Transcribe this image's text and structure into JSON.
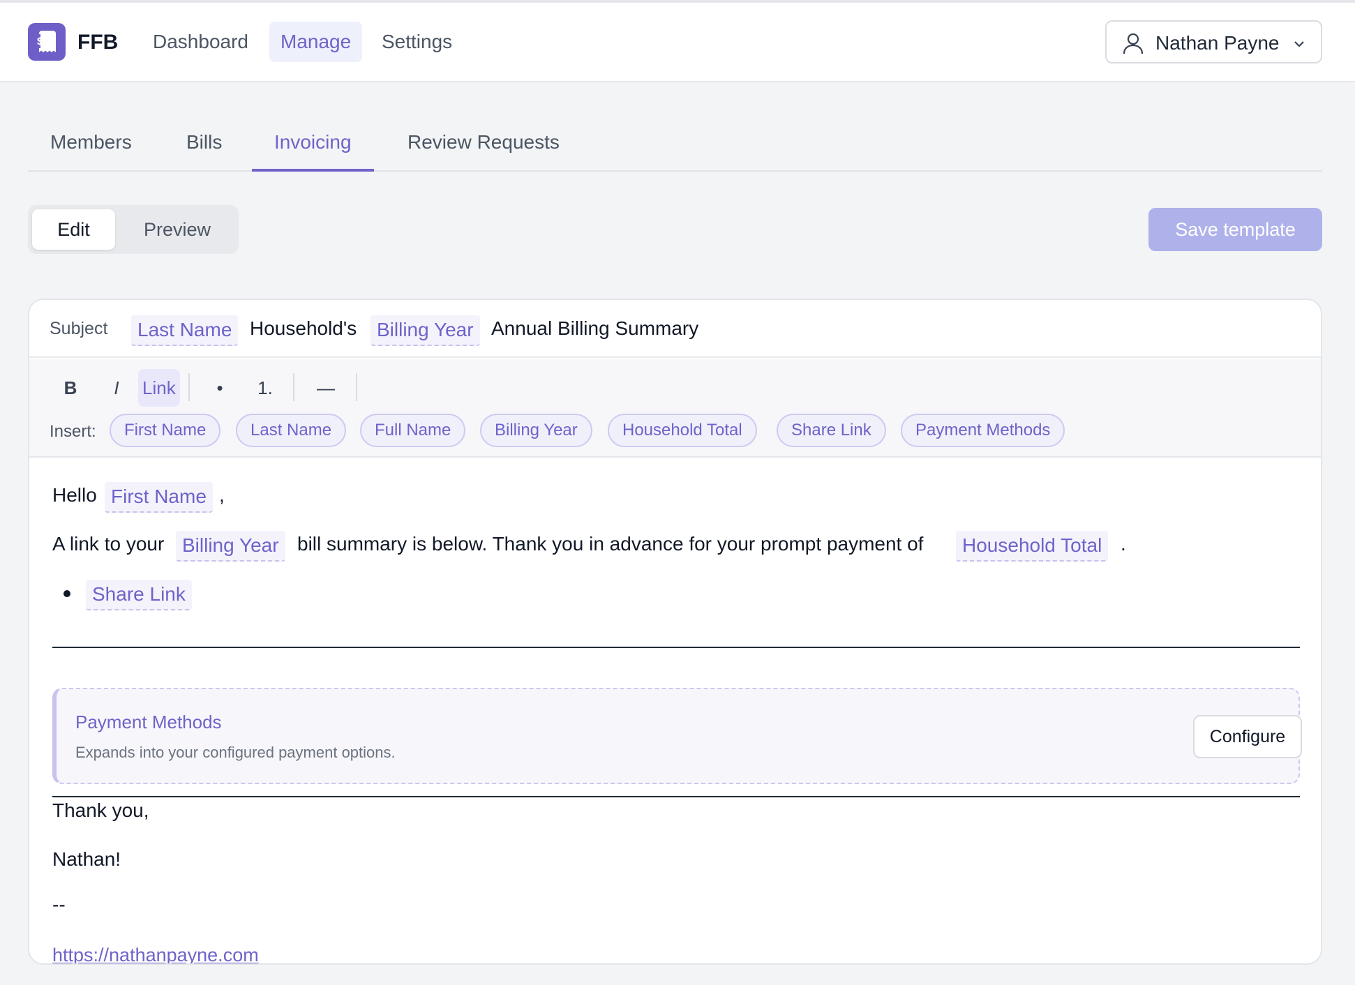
{
  "app": {
    "brand": "FFB"
  },
  "nav": {
    "items": [
      {
        "label": "Dashboard"
      },
      {
        "label": "Manage",
        "active": true
      },
      {
        "label": "Settings"
      }
    ],
    "user": {
      "name": "Nathan Payne",
      "icon": "user-icon"
    }
  },
  "tabs": [
    {
      "label": "Members"
    },
    {
      "label": "Bills"
    },
    {
      "label": "Invoicing",
      "active": true
    },
    {
      "label": "Review Requests"
    }
  ],
  "mode": {
    "edit": "Edit",
    "preview": "Preview",
    "selected": "Edit"
  },
  "save_button": "Save template",
  "subject": {
    "label": "Subject",
    "tokens": [
      "Last Name",
      "Household's",
      "Billing Year",
      "Annual Billing Summary"
    ]
  },
  "toolbar": {
    "bold": "B",
    "italic": "I",
    "link": "Link",
    "bullet": "•",
    "ordered": "1.",
    "rule": "—",
    "insert_label": "Insert:",
    "variables": [
      "First Name",
      "Last Name",
      "Full Name",
      "Billing Year",
      "Household Total",
      "Share Link",
      "Payment Methods"
    ]
  },
  "body": {
    "greeting": "Hello",
    "greeting_var": "First Name",
    "greeting_end": ",",
    "line2_a": "A link to your",
    "line2_var1": "Billing Year",
    "line2_b": "bill summary is below. Thank you in advance for your prompt payment of",
    "line2_var2": "Household Total",
    "line2_end": ".",
    "bullet_var": "Share Link",
    "payment_block": {
      "title": "Payment Methods",
      "description": "Expands into your configured payment options.",
      "button": "Configure"
    },
    "closing": "Thank you,",
    "signature": "Nathan!",
    "separator": "--",
    "url": "https://nathanpayne.com"
  },
  "colors": {
    "accent": "#6d63c9",
    "accent_light": "#eef0fb",
    "save_disabled": "#aeb1ea",
    "background": "#f3f4f6"
  }
}
